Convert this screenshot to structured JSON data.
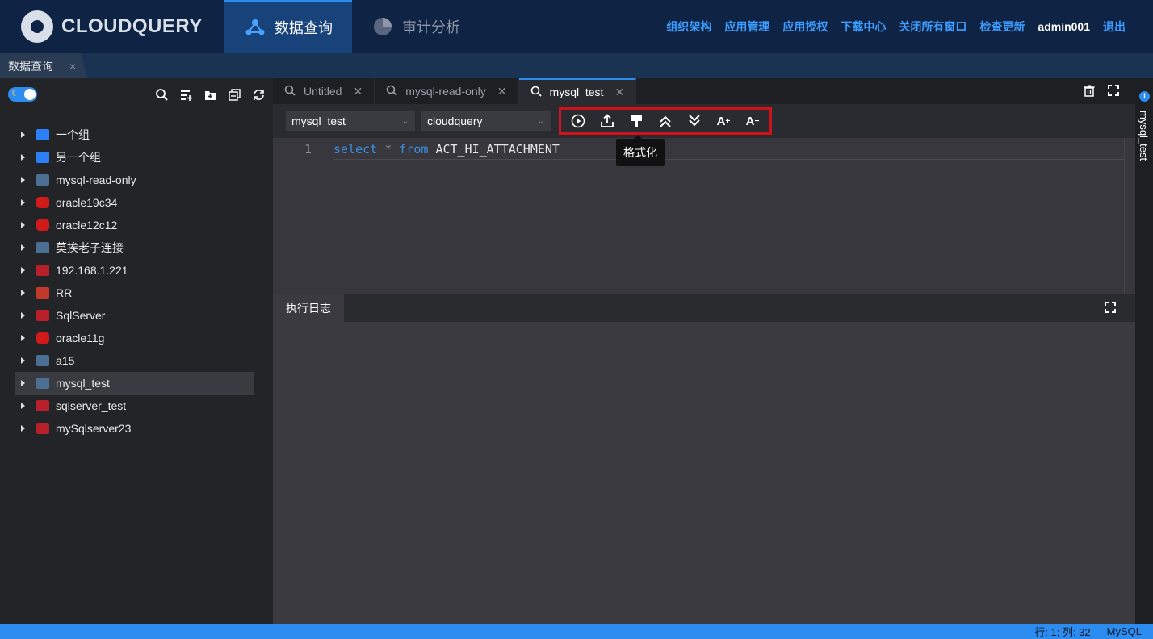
{
  "app": {
    "logo_text": "CLOUDQUERY"
  },
  "nav": {
    "tabs": [
      {
        "label": "数据查询",
        "icon": "network-icon",
        "active": true
      },
      {
        "label": "审计分析",
        "icon": "pie-chart-icon",
        "active": false
      }
    ],
    "links": [
      "组织架构",
      "应用管理",
      "应用授权",
      "下载中心",
      "关闭所有窗口",
      "检查更新"
    ],
    "user": "admin001",
    "logout": "退出"
  },
  "page_tab": {
    "label": "数据查询",
    "close": "×"
  },
  "sidebar": {
    "tree": [
      {
        "label": "一个组",
        "icon": "folder-icon"
      },
      {
        "label": "另一个组",
        "icon": "folder-icon"
      },
      {
        "label": "mysql-read-only",
        "icon": "mysql-icon"
      },
      {
        "label": "oracle19c34",
        "icon": "oracle-icon"
      },
      {
        "label": "oracle12c12",
        "icon": "oracle-icon"
      },
      {
        "label": "莫挨老子连接",
        "icon": "mysql-icon"
      },
      {
        "label": "192.168.1.221",
        "icon": "sqlserver-icon"
      },
      {
        "label": "RR",
        "icon": "redis-icon"
      },
      {
        "label": "SqlServer",
        "icon": "sqlserver-icon"
      },
      {
        "label": "oracle11g",
        "icon": "oracle-icon"
      },
      {
        "label": "a15",
        "icon": "mysql-icon"
      },
      {
        "label": "mysql_test",
        "icon": "mysql-icon",
        "selected": true
      },
      {
        "label": "sqlserver_test",
        "icon": "sqlserver-icon"
      },
      {
        "label": "mySqlserver23",
        "icon": "sqlserver-icon"
      }
    ]
  },
  "editor": {
    "tabs": [
      {
        "label": "Untitled",
        "active": false
      },
      {
        "label": "mysql-read-only",
        "active": false
      },
      {
        "label": "mysql_test",
        "active": true
      }
    ],
    "connection_select": "mysql_test",
    "database_select": "cloudquery",
    "line_number": "1",
    "code": {
      "kw1": "select",
      "op": "*",
      "kw2": "from",
      "table": "ACT_HI_ATTACHMENT"
    },
    "tooltip": "格式化"
  },
  "log": {
    "tab_label": "执行日志"
  },
  "right_panel": {
    "label": "mysql_test"
  },
  "status": {
    "position": "行: 1; 列: 32",
    "dialect": "MySQL"
  }
}
